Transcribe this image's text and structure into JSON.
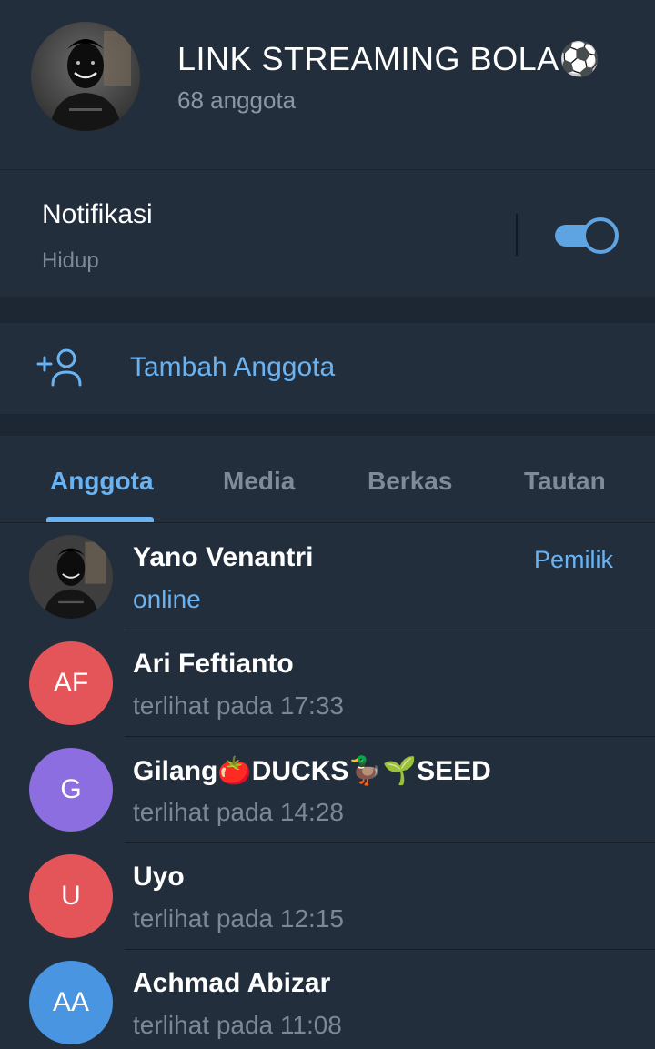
{
  "group": {
    "title": "LINK STREAMING BOLA⚽",
    "subtitle": "68 anggota",
    "avatar_icon": "masked-person-avatar"
  },
  "notifications": {
    "title": "Notifikasi",
    "status": "Hidup",
    "enabled": true
  },
  "add_member": {
    "label": "Tambah Anggota",
    "icon": "add-user-icon"
  },
  "tabs": [
    {
      "label": "Anggota",
      "active": true
    },
    {
      "label": "Media",
      "active": false
    },
    {
      "label": "Berkas",
      "active": false
    },
    {
      "label": "Tautan",
      "active": false
    }
  ],
  "members": [
    {
      "name": "Yano Venantri",
      "status": "online",
      "role": "Pemilik",
      "initials": "",
      "avatar": "photo"
    },
    {
      "name": "Ari Feftianto",
      "status": "terlihat pada  17:33",
      "role": "",
      "initials": "AF",
      "avatar_color": "#e4555a"
    },
    {
      "name": "Gilang🍅DUCKS🦆🌱SEED",
      "status": "terlihat pada  14:28",
      "role": "",
      "initials": "G",
      "avatar_color": "#8c6ee0"
    },
    {
      "name": "Uyo",
      "status": "terlihat pada  12:15",
      "role": "",
      "initials": "U",
      "avatar_color": "#e4555a"
    },
    {
      "name": "Achmad Abizar",
      "status": "terlihat pada  11:08",
      "role": "",
      "initials": "AA",
      "avatar_color": "#4a95e2"
    }
  ],
  "colors": {
    "accent": "#6ab3f3",
    "background": "#1d2733",
    "panel": "#232e3c"
  }
}
